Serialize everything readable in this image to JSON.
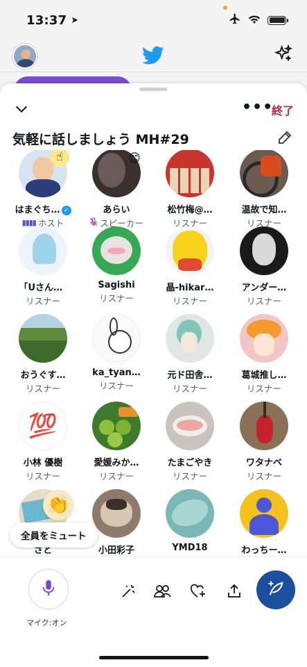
{
  "status_bar": {
    "time": "13:37"
  },
  "space": {
    "end_label": "終了",
    "title": "気軽に話しましょう MH#29"
  },
  "participants": [
    {
      "name": "はまぐち…",
      "role": "ホスト",
      "verified": true,
      "role_icon": "host-bars-icon"
    },
    {
      "name": "あらい",
      "role": "スピーカー",
      "role_icon": "mic-muted-icon"
    },
    {
      "name": "松竹梅@…",
      "role": "リスナー"
    },
    {
      "name": "温故で知…",
      "role": "リスナー"
    },
    {
      "name": "｢Uさん…",
      "role": "リスナー"
    },
    {
      "name": "Sagishi",
      "role": "リスナー"
    },
    {
      "name": "晶-hikar…",
      "role": "リスナー"
    },
    {
      "name": "アンダー…",
      "role": "リスナー"
    },
    {
      "name": "おうぐす…",
      "role": "リスナー"
    },
    {
      "name": "ka_tyan…",
      "role": "リスナー"
    },
    {
      "name": "元ド田舎…",
      "role": "リスナー"
    },
    {
      "name": "葛城推し…",
      "role": "リスナー"
    },
    {
      "name": "小林 優樹",
      "role": "リスナー"
    },
    {
      "name": "愛媛みか…",
      "role": "リスナー"
    },
    {
      "name": "たまごやき",
      "role": "リスナー"
    },
    {
      "name": "ワタナベ",
      "role": "リスナー"
    },
    {
      "name": "さと",
      "role": ""
    },
    {
      "name": "小田彩子",
      "role": ""
    },
    {
      "name": "YMD18",
      "role": ""
    },
    {
      "name": "わっちー…",
      "role": ""
    }
  ],
  "mute_all_label": "全員をミュート",
  "toolbar": {
    "mic_label": "マイク:オン"
  },
  "colors": {
    "end": "#c0254b",
    "compose": "#1a4f9c",
    "host": "#4a55d6",
    "speaker_mute": "#b0359c"
  },
  "icons": [
    "location-arrow-icon",
    "airplane-icon",
    "wifi-icon",
    "battery-icon",
    "twitter-bird-icon",
    "sparkle-icon",
    "chevron-down-icon",
    "more-icon",
    "pencil-icon",
    "magic-wand-icon",
    "people-icon",
    "heart-plus-icon",
    "share-icon",
    "compose-icon",
    "microphone-icon"
  ]
}
